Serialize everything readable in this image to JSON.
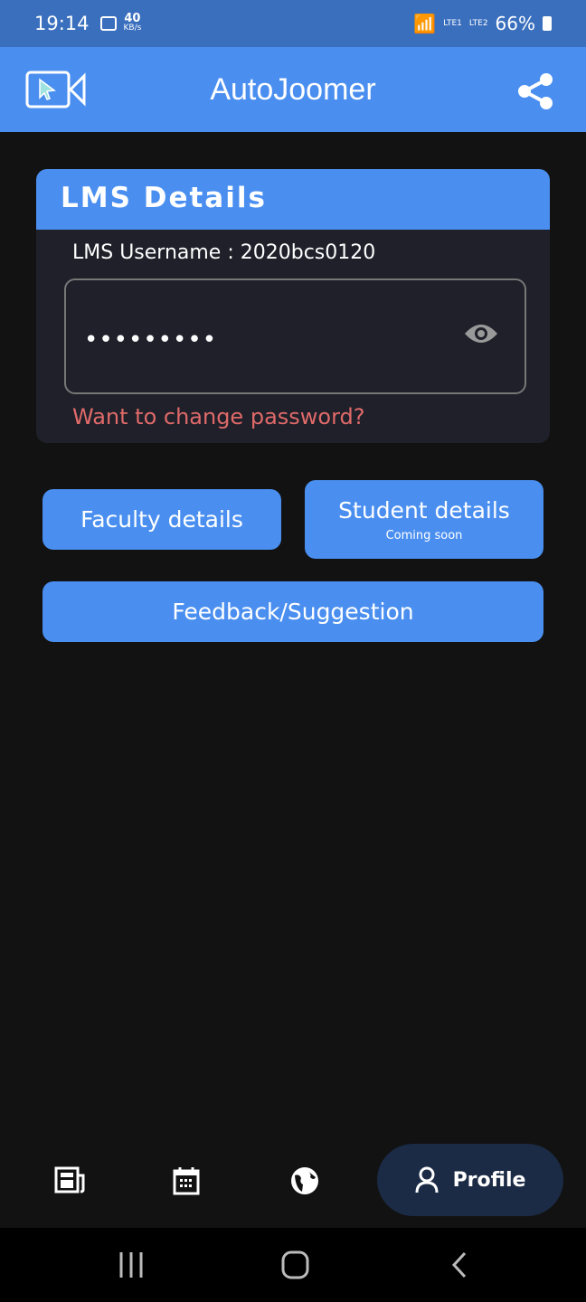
{
  "status_bar": {
    "time": "19:14",
    "net_speed": "40",
    "net_unit": "KB/s",
    "sim1": "LTE1",
    "sim2": "LTE2",
    "battery": "66%"
  },
  "app_bar": {
    "title": "AutoJoomer",
    "logo_icon": "video-cursor-icon",
    "share_icon": "share-icon"
  },
  "lms_card": {
    "title": "LMS Details",
    "username_label": "LMS Username : 2020bcs0120",
    "password_value": "•••••••••",
    "change_password": "Want to change password?"
  },
  "buttons": {
    "faculty": "Faculty details",
    "student": "Student details",
    "student_sub": "Coming soon",
    "feedback": "Feedback/Suggestion"
  },
  "bottom_nav": {
    "items": [
      {
        "icon": "newspaper-icon"
      },
      {
        "icon": "calendar-icon"
      },
      {
        "icon": "globe-icon"
      },
      {
        "icon": "person-icon",
        "label": "Profile",
        "active": true
      }
    ]
  },
  "colors": {
    "accent": "#4a8ff0",
    "error": "#e06a6a",
    "background": "#121212"
  }
}
